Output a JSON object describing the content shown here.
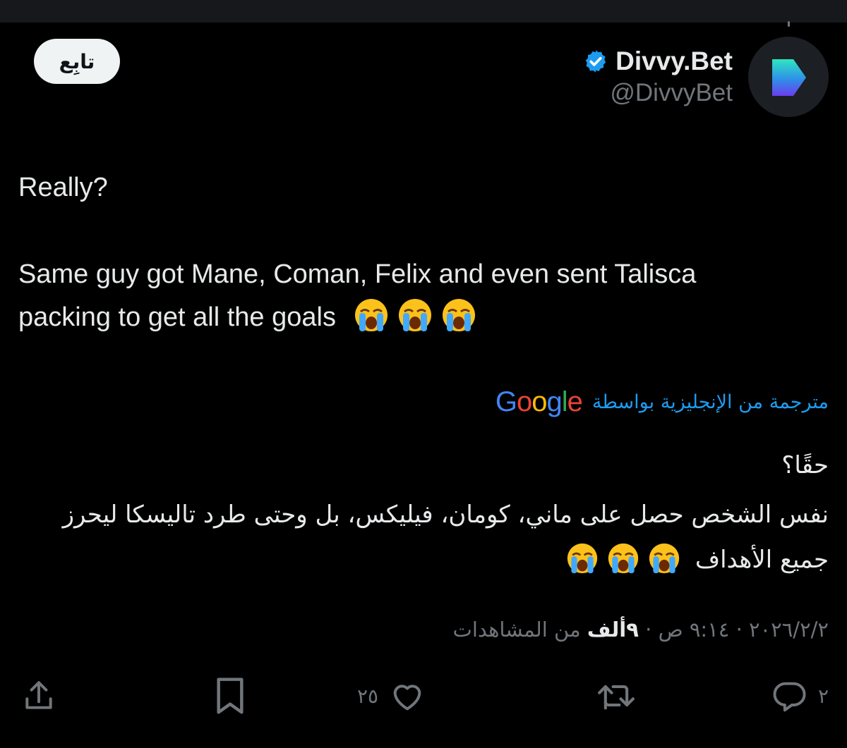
{
  "header": {
    "follow_label": "تابِع",
    "display_name": "Divvy.Bet",
    "handle": "@DivvyBet",
    "verified": true
  },
  "tweet": {
    "line1": "Really?",
    "line2": "Same guy got Mane, Coman, Felix and even sent Talisca",
    "line3": "packing to get all the goals",
    "emoji": "loudly-crying-face"
  },
  "translation": {
    "label": "مترجمة من الإنجليزية بواسطة",
    "provider": "Google",
    "line1": "حقًا؟",
    "line2": "نفس الشخص حصل على ماني، كومان، فيليكس، بل وحتى طرد تاليسكا ليحرز",
    "line3": "جميع الأهداف"
  },
  "meta": {
    "date": "٢٠٢٦/٢/٢",
    "sep": "·",
    "time": "٩:١٤ ص",
    "views_count": "٩ألف",
    "views_label": "من المشاهدات"
  },
  "actions": {
    "replies": "٢",
    "retweets": "",
    "likes": "٢٥",
    "icons": [
      "reply-icon",
      "retweet-icon",
      "like-icon",
      "bookmark-icon",
      "share-icon"
    ]
  },
  "colors": {
    "background": "#000000",
    "text": "#e7e9ea",
    "secondary": "#71767b",
    "link": "#1d9bf0",
    "verified": "#1d9bf0"
  }
}
